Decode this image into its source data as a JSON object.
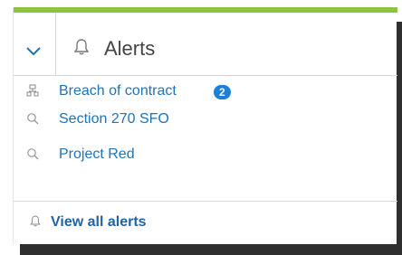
{
  "header": {
    "title": "Alerts",
    "toggle_icon": "chevron-down-icon",
    "title_icon": "bell-icon"
  },
  "alerts": [
    {
      "label": "Breach of contract",
      "icon": "hierarchy-icon",
      "badge": "2"
    },
    {
      "label": "Section 270 SFO",
      "icon": "search-icon"
    },
    {
      "label": "Project Red",
      "icon": "search-icon"
    }
  ],
  "footer": {
    "view_all_label": "View all alerts",
    "icon": "bell-icon"
  },
  "colors": {
    "accent": "#8cc43c",
    "link": "#1f73b7",
    "badge": "#1e7fd6"
  }
}
